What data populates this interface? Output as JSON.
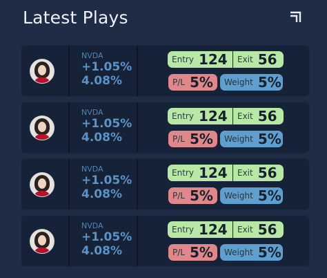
{
  "header": {
    "title": "Latest Plays",
    "expand_icon": "expand-corner-icon"
  },
  "colors": {
    "background": "#1f2c46",
    "card": "#162238",
    "entry_exit": "#b9e8a6",
    "pl": "#e0878b",
    "weight": "#5f9fd0",
    "accent_text": "#5c93c4"
  },
  "plays": [
    {
      "ticker": "NVDA",
      "change": "+1.05%",
      "percent": "4.08%",
      "entry_label": "Entry",
      "entry": "124",
      "exit_label": "Exit",
      "exit": "56",
      "pl_label": "P/L",
      "pl": "5%",
      "weight_label": "Weight",
      "weight": "5%"
    },
    {
      "ticker": "NVDA",
      "change": "+1.05%",
      "percent": "4.08%",
      "entry_label": "Entry",
      "entry": "124",
      "exit_label": "Exit",
      "exit": "56",
      "pl_label": "P/L",
      "pl": "5%",
      "weight_label": "Weight",
      "weight": "5%"
    },
    {
      "ticker": "NVDA",
      "change": "+1.05%",
      "percent": "4.08%",
      "entry_label": "Entry",
      "entry": "124",
      "exit_label": "Exit",
      "exit": "56",
      "pl_label": "P/L",
      "pl": "5%",
      "weight_label": "Weight",
      "weight": "5%"
    },
    {
      "ticker": "NVDA",
      "change": "+1.05%",
      "percent": "4.08%",
      "entry_label": "Entry",
      "entry": "124",
      "exit_label": "Exit",
      "exit": "56",
      "pl_label": "P/L",
      "pl": "5%",
      "weight_label": "Weight",
      "weight": "5%"
    }
  ]
}
